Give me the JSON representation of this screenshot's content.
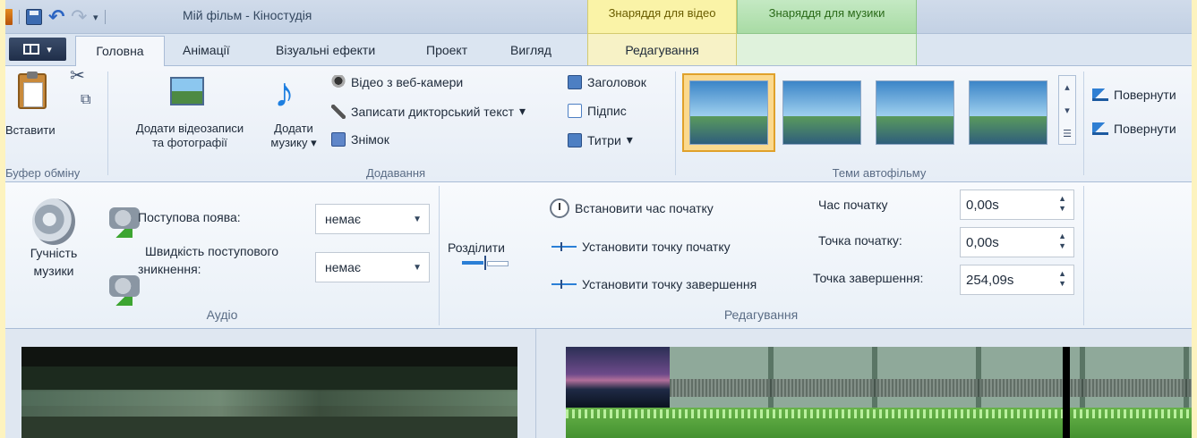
{
  "titlebar": {
    "window_title": "Мій фільм - Кіностудія",
    "context_video": "Знаряддя для відео",
    "context_music": "Знаряддя для музики"
  },
  "tabs": {
    "active": "Головна",
    "items": [
      "Анімації",
      "Візуальні ефекти",
      "Проект",
      "Вигляд",
      "Редагування"
    ]
  },
  "home_ribbon": {
    "clipboard": {
      "paste": "Вставити",
      "group": "Буфер обміну"
    },
    "add": {
      "add_videos_line1": "Додати відеозаписи",
      "add_videos_line2": "та фотографії",
      "add_music_line1": "Додати",
      "add_music_line2": "музику",
      "webcam": "Відео з веб-камери",
      "narration": "Записати дикторський текст",
      "snapshot": "Знімок",
      "title": "Заголовок",
      "caption": "Підпис",
      "credits": "Титри",
      "group": "Додавання"
    },
    "themes": {
      "group": "Теми автофільму"
    },
    "rotate": {
      "rotate_left": "Повернути",
      "rotate_right": "Повернути"
    }
  },
  "music_ribbon": {
    "audio": {
      "volume_line1": "Гучність",
      "volume_line2": "музики",
      "fade_in_label": "Поступова поява:",
      "fade_in_value": "немає",
      "fade_out_label_line1": "Швидкість поступового",
      "fade_out_label_line2": "зникнення:",
      "fade_out_value": "немає",
      "group": "Аудіо"
    },
    "edit": {
      "split": "Розділити",
      "set_start_time": "Встановити час початку",
      "set_start_point": "Установити точку початку",
      "set_end_point": "Установити точку завершення",
      "start_time_label": "Час початку",
      "start_time_value": "0,00s",
      "start_point_label": "Точка початку:",
      "start_point_value": "0,00s",
      "end_point_label": "Точка завершення:",
      "end_point_value": "254,09s",
      "group": "Редагування"
    }
  }
}
